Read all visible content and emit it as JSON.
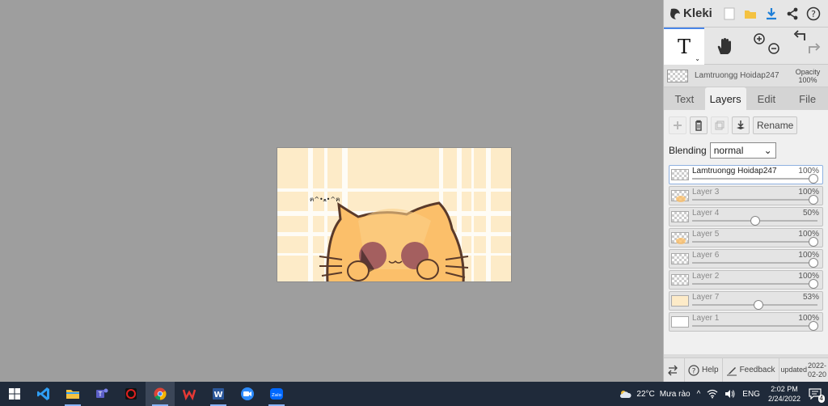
{
  "app": {
    "name": "Kleki"
  },
  "toolbar": {
    "active_tool": "text-tool",
    "text_tool_glyph": "T"
  },
  "color_row": {
    "layer_name": "Lamtruongg Hoidap247",
    "opacity_label": "Opacity",
    "opacity_value": "100%"
  },
  "tabs": [
    {
      "label": "Text",
      "active": false
    },
    {
      "label": "Layers",
      "active": true
    },
    {
      "label": "Edit",
      "active": false
    },
    {
      "label": "File",
      "active": false
    }
  ],
  "layer_actions": {
    "rename_label": "Rename"
  },
  "blending": {
    "label": "Blending",
    "value": "normal"
  },
  "layers": [
    {
      "name": "Lamtruongg Hoidap247",
      "opacity": "100%",
      "opacity_value": 1.0,
      "selected": true,
      "thumb": "checker"
    },
    {
      "name": "Layer 3",
      "opacity": "100%",
      "opacity_value": 1.0,
      "selected": false,
      "thumb": "checker-cat"
    },
    {
      "name": "Layer 4",
      "opacity": "50%",
      "opacity_value": 0.5,
      "selected": false,
      "thumb": "checker"
    },
    {
      "name": "Layer 5",
      "opacity": "100%",
      "opacity_value": 1.0,
      "selected": false,
      "thumb": "checker-cat"
    },
    {
      "name": "Layer 6",
      "opacity": "100%",
      "opacity_value": 1.0,
      "selected": false,
      "thumb": "checker"
    },
    {
      "name": "Layer 2",
      "opacity": "100%",
      "opacity_value": 1.0,
      "selected": false,
      "thumb": "checker"
    },
    {
      "name": "Layer 7",
      "opacity": "53%",
      "opacity_value": 0.53,
      "selected": false,
      "thumb": "cream"
    },
    {
      "name": "Layer 1",
      "opacity": "100%",
      "opacity_value": 1.0,
      "selected": false,
      "thumb": "white"
    }
  ],
  "bottom_bar": {
    "help_label": "Help",
    "feedback_label": "Feedback",
    "updated_label": "updated",
    "updated_date": "2022-02-20"
  },
  "canvas": {
    "text": "ฅ^•ﻌ•^ฅ"
  },
  "taskbar": {
    "apps": [
      "windows-start",
      "vscode",
      "file-explorer",
      "teams",
      "garena",
      "chrome",
      "wps",
      "word",
      "zoom",
      "zalo"
    ],
    "weather_temp": "22°C",
    "weather_text": "Mưa rào",
    "language": "ENG",
    "time": "2:02 PM",
    "date": "2/24/2022",
    "notification_count": "4"
  },
  "colors": {
    "accent": "#4a86e8",
    "canvas_bg": "#fdebc8",
    "workspace_bg": "#9e9e9e",
    "taskbar_bg": "#1f2a3a"
  }
}
